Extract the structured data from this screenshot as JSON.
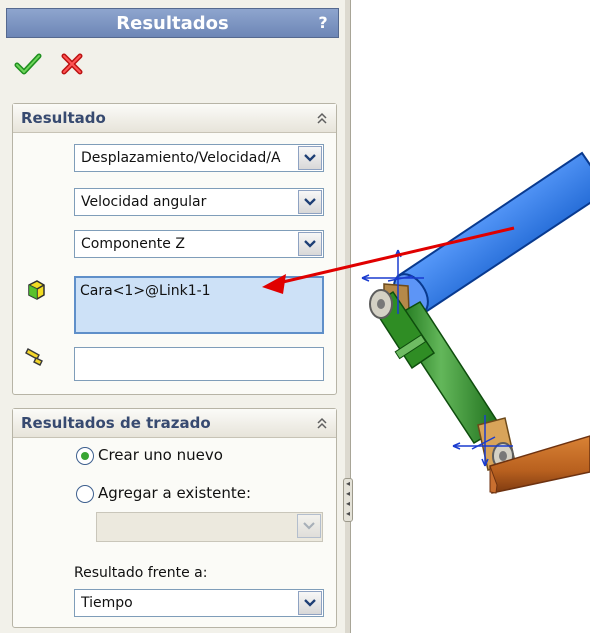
{
  "window": {
    "title": "Resultados",
    "help": "?"
  },
  "actions": {
    "ok": "ok",
    "cancel": "cancel"
  },
  "result": {
    "section_title": "Resultado",
    "category_value": "Desplazamiento/Velocidad/A",
    "subcategory_value": "Velocidad angular",
    "component_value": "Componente Z",
    "selected_entity": "Cara<1>@Link1-1",
    "reference_value": ""
  },
  "plot_results": {
    "section_title": "Resultados de trazado",
    "option_new": "Crear uno nuevo",
    "option_existing": "Agregar a existente:",
    "existing_value": "",
    "versus_label": "Resultado frente a:",
    "versus_value": "Tiempo"
  },
  "colors": {
    "title_bar": "#6d86b6",
    "selection_fill": "#cde1f7",
    "arrow": "#e00000",
    "blue_link": "#1f67d3",
    "green_link": "#2f8d24",
    "orange_link": "#b9611f"
  }
}
